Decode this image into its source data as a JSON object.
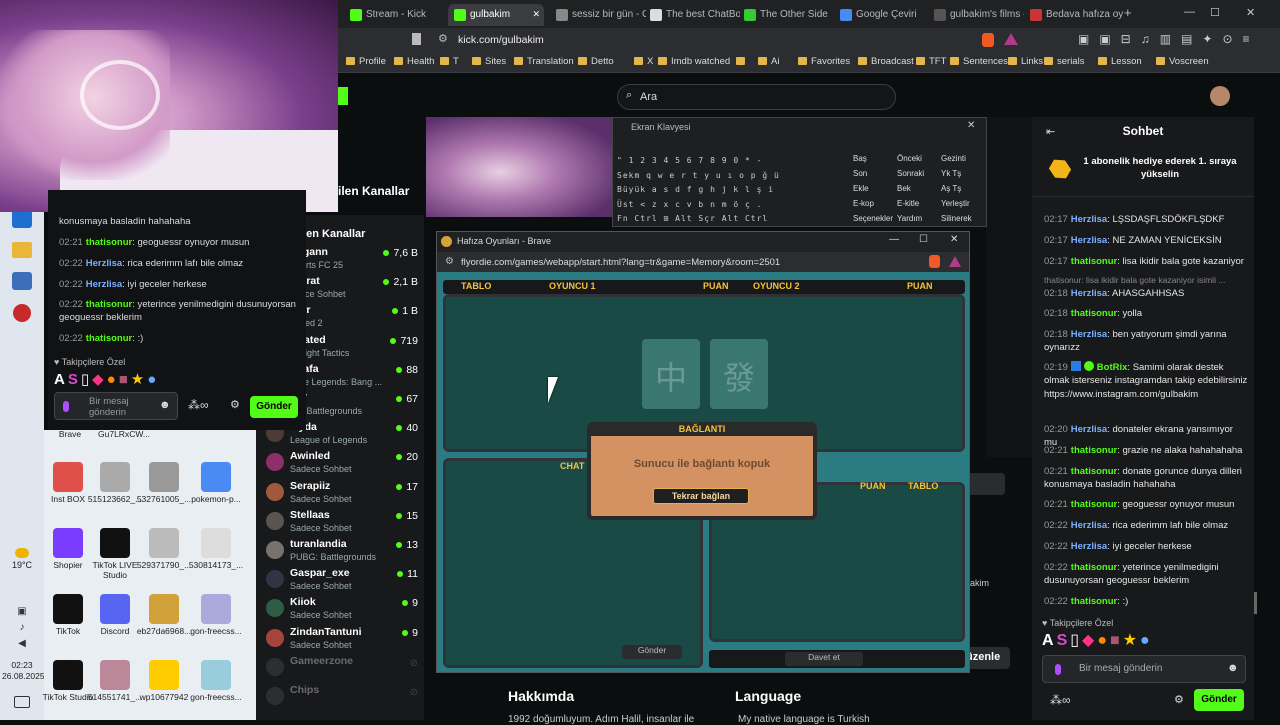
{
  "desktop": {
    "weather": "19°C",
    "time": "02:23",
    "date": "26.08.2025",
    "icons": [
      {
        "label": "Brave"
      },
      {
        "label": "Gu7LRxCW..."
      },
      {
        "label": "Inst BOX"
      },
      {
        "label": "515123662_..."
      },
      {
        "label": "532761005_..."
      },
      {
        "label": "pokemon-p..."
      },
      {
        "label": "Shopier"
      },
      {
        "label": "TikTok LIVE Studio"
      },
      {
        "label": "529371790_..."
      },
      {
        "label": "530814173_..."
      },
      {
        "label": "TikTok"
      },
      {
        "label": "Discord"
      },
      {
        "label": "eb27da6968..."
      },
      {
        "label": "gon-freecss..."
      },
      {
        "label": "TikTok Studio"
      },
      {
        "label": "514551741_..."
      },
      {
        "label": "wp10677942"
      },
      {
        "label": "gon-freecss..."
      }
    ]
  },
  "browser": {
    "tabs": [
      {
        "label": "Stream - Kick",
        "color": "#53fc18"
      },
      {
        "label": "gulbakim",
        "color": "#53fc18",
        "active": true
      },
      {
        "label": "sessiz bir gün - G",
        "color": "#888"
      },
      {
        "label": "The best ChatBot",
        "color": "#ddd"
      },
      {
        "label": "The Other Side",
        "color": "#3c3"
      },
      {
        "label": "Google Çeviri",
        "color": "#4a8af4"
      },
      {
        "label": "gulbakim's films -",
        "color": "#555"
      },
      {
        "label": "Bedava hafıza oy",
        "color": "#c33"
      }
    ],
    "url": "kick.com/gulbakim",
    "bookmarks": [
      "Profile",
      "Health",
      "T",
      "Sites",
      "Translation",
      "Detto",
      "X",
      "Imdb watched",
      "",
      "Ai",
      "Favorites",
      "Broadcast",
      "TFT",
      "Sentences",
      "Links",
      "serials",
      "Lesson",
      "Voscreen"
    ]
  },
  "kick": {
    "search_placeholder": "Ara",
    "recommended_header": "ilen Kanallar",
    "follow_header": "ilen Kanallar",
    "channels": [
      {
        "name": "dogann",
        "cat": "Sports FC 25",
        "viewers": "7,6 B"
      },
      {
        "name": "erfirat",
        "cat": "adece Sohbet",
        "viewers": "2,1 B"
      },
      {
        "name": "vorr",
        "cat": "unded 2",
        "viewers": "1 B"
      },
      {
        "name": "arrated",
        "cat": "amfight Tactics",
        "viewers": "719"
      },
      {
        "name": "rtkafa",
        "cat": "obile Legends: Bang ...",
        "viewers": "88"
      },
      {
        "name": "utV",
        "cat": "JG: Battlegrounds",
        "viewers": "67"
      },
      {
        "name": "layda",
        "cat": "League of Legends",
        "viewers": "40"
      },
      {
        "name": "Awinled",
        "cat": "Sadece Sohbet",
        "viewers": "20"
      },
      {
        "name": "Serapiiz",
        "cat": "Sadece Sohbet",
        "viewers": "17"
      },
      {
        "name": "Stellaas",
        "cat": "Sadece Sohbet",
        "viewers": "15"
      },
      {
        "name": "turanlandia",
        "cat": "PUBG: Battlegrounds",
        "viewers": "13"
      },
      {
        "name": "Gaspar_exe",
        "cat": "Sadece Sohbet",
        "viewers": "11"
      },
      {
        "name": "Kiiok",
        "cat": "Sadece Sohbet",
        "viewers": "9"
      },
      {
        "name": "ZindanTantuni",
        "cat": "Sadece Sohbet",
        "viewers": "9"
      },
      {
        "name": "Gameerzone",
        "cat": "",
        "viewers": ""
      },
      {
        "name": "Chips",
        "cat": "",
        "viewers": ""
      }
    ],
    "about_title": "Hakkımda",
    "about_text": "1992 doğumluyum. Adım Halil, insanlar ile",
    "language_title": "Language",
    "language_text": "My native language is Turkish",
    "btn_partial1": "tirin",
    "btn_partial2": "üzenle",
    "partial3": "akim"
  },
  "mini_chat": {
    "top": "konusmaya basladin hahahaha",
    "messages": [
      {
        "t": "02:21",
        "u": "thatisonur",
        "c": "g",
        "m": "geoguessr oynuyor musun"
      },
      {
        "t": "02:22",
        "u": "Herzlisa",
        "c": "b",
        "m": "rica ederimm lafı bile olmaz"
      },
      {
        "t": "02:22",
        "u": "Herzlisa",
        "c": "b",
        "m": "iyi geceler herkese"
      },
      {
        "t": "02:22",
        "u": "thatisonur",
        "c": "g",
        "m": "yeterince yenilmedigini dusunuyorsan geoguessr beklerim"
      },
      {
        "t": "02:22",
        "u": "thatisonur",
        "c": "g",
        "m": ":)"
      }
    ],
    "favs_label": "Takipçilere Özel",
    "input_placeholder": "Bir mesaj gönderin",
    "send": "Gönder"
  },
  "chat": {
    "title": "Sohbet",
    "sub_banner": "1 abonelik hediye ederek 1. sıraya yükselin",
    "messages": [
      {
        "t": "02:17",
        "u": "Herzlisa",
        "c": "b",
        "m": "LŞSDAŞFLSDÖKFLŞDKF"
      },
      {
        "t": "02:17",
        "u": "Herzlisa",
        "c": "b",
        "m": "NE ZAMAN YENİCEKSİN"
      },
      {
        "t": "02:17",
        "u": "thatisonur",
        "c": "g",
        "m": "lisa ikidir bala gote kazaniyor"
      },
      {
        "t": "",
        "u": "",
        "c": "",
        "m": "thatisonur: lisa ikidir bala gote kazaniyor isimli ..."
      },
      {
        "t": "02:18",
        "u": "Herzlisa",
        "c": "b",
        "m": "AHASGAHHSAS"
      },
      {
        "t": "02:18",
        "u": "thatisonur",
        "c": "g",
        "m": "yolla"
      },
      {
        "t": "02:18",
        "u": "Herzlisa",
        "c": "b",
        "m": "ben yatıyorum şimdi yarına oynarızz"
      },
      {
        "t": "02:19",
        "u": "BotRix",
        "c": "g",
        "m": "Samimi olarak destek olmak isterseniz instagramdan takip edebilirsiniz https://www.instagram.com/gulbakim"
      },
      {
        "t": "02:20",
        "u": "Herzlisa",
        "c": "b",
        "m": "donateler ekrana yansımıyor mu"
      },
      {
        "t": "02:21",
        "u": "thatisonur",
        "c": "g",
        "m": "grazie ne alaka hahahahaha"
      },
      {
        "t": "02:21",
        "u": "thatisonur",
        "c": "g",
        "m": "donate gorunce dunya dilleri konusmaya basladin hahahaha"
      },
      {
        "t": "02:21",
        "u": "thatisonur",
        "c": "g",
        "m": "geoguessr oynuyor musun"
      },
      {
        "t": "02:22",
        "u": "Herzlisa",
        "c": "b",
        "m": "rica ederimm lafı bile olmaz"
      },
      {
        "t": "02:22",
        "u": "Herzlisa",
        "c": "b",
        "m": "iyi geceler herkese"
      },
      {
        "t": "02:22",
        "u": "thatisonur",
        "c": "g",
        "m": "yeterince yenilmedigini dusunuyorsan geoguessr beklerim"
      },
      {
        "t": "02:22",
        "u": "thatisonur",
        "c": "g",
        "m": ":)"
      }
    ],
    "favs_label": "Takipçilere Özel",
    "input_placeholder": "Bir mesaj gönderin",
    "send": "Gönder"
  },
  "osk": {
    "title": "Ekran Klavyesi",
    "right": [
      "Baş",
      "Önceki",
      "Gezinti",
      "Son",
      "Sonraki",
      "Yk Tş",
      "Ekle",
      "Bek",
      "Aş Tş",
      "E-kop",
      "E-kitle",
      "Yerleştir",
      "Seçenekler",
      "Yardım",
      "Silinerek"
    ]
  },
  "game": {
    "window_title": "Hafıza Oyunları - Brave",
    "url": "flyordie.com/games/webapp/start.html?lang=tr&game=Memory&room=2501",
    "hdr": {
      "tablo": "TABLO",
      "p1": "OYUNCU 1",
      "puan": "PUAN",
      "p2": "OYUNCU 2",
      "puan2": "PUAN"
    },
    "chat_label": "CHAT",
    "send": "Gönder",
    "invite": "Davet et",
    "puan3": "PUAN",
    "tablo3": "TABLO",
    "dialog_title": "BAĞLANTI",
    "dialog_msg": "Sunucu ile bağlantı kopuk",
    "dialog_btn": "Tekrar bağlan",
    "tile1": "中",
    "tile2": "發"
  }
}
